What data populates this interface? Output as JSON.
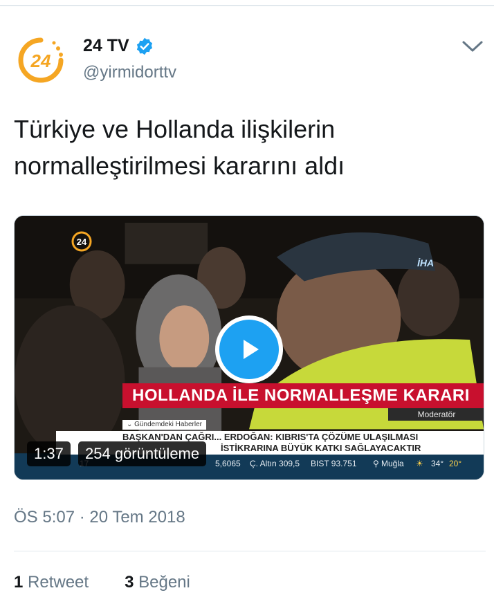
{
  "account": {
    "display_name": "24 TV",
    "handle": "@yirmidorttv",
    "verified": true,
    "brand_color": "#f5a623"
  },
  "tweet": {
    "text": "Türkiye ve Hollanda ilişkilerin normalleştirilmesi kararını aldı",
    "timestamp": "ÖS 5:07 · 20 Tem 2018"
  },
  "video": {
    "channel_logo": "24",
    "agency_logo": "İHA",
    "banner": "HOLLANDA İLE NORMALLEŞME KARARI",
    "caption_tag": "Moderatör",
    "section_label": "Gündemdeki Haberler",
    "ticker_line1": "BAŞKAN'DAN ÇAĞRI... ERDOĞAN: KIBRIS'TA ÇÖZÜME ULAŞILMASI",
    "ticker_line2": "İSTİKRARINA BÜYÜK KATKI SAĞLAYACAKTIR",
    "market": {
      "item1": "17",
      "item2": "5,6065",
      "item3": "Ç. Altın  309,5",
      "item4": "BIST  93.751",
      "location": "Muğla",
      "temp_high": "34°",
      "temp_low": "20°"
    },
    "duration": "1:37",
    "views": "254 görüntüleme",
    "play_color": "#1da1f2"
  },
  "stats": {
    "retweets_count": "1",
    "retweets_label": "Retweet",
    "likes_count": "3",
    "likes_label": "Beğeni"
  },
  "icons": [
    "verified-badge-icon",
    "chevron-down-icon",
    "play-icon",
    "location-pin-icon",
    "sun-cloud-icon"
  ]
}
